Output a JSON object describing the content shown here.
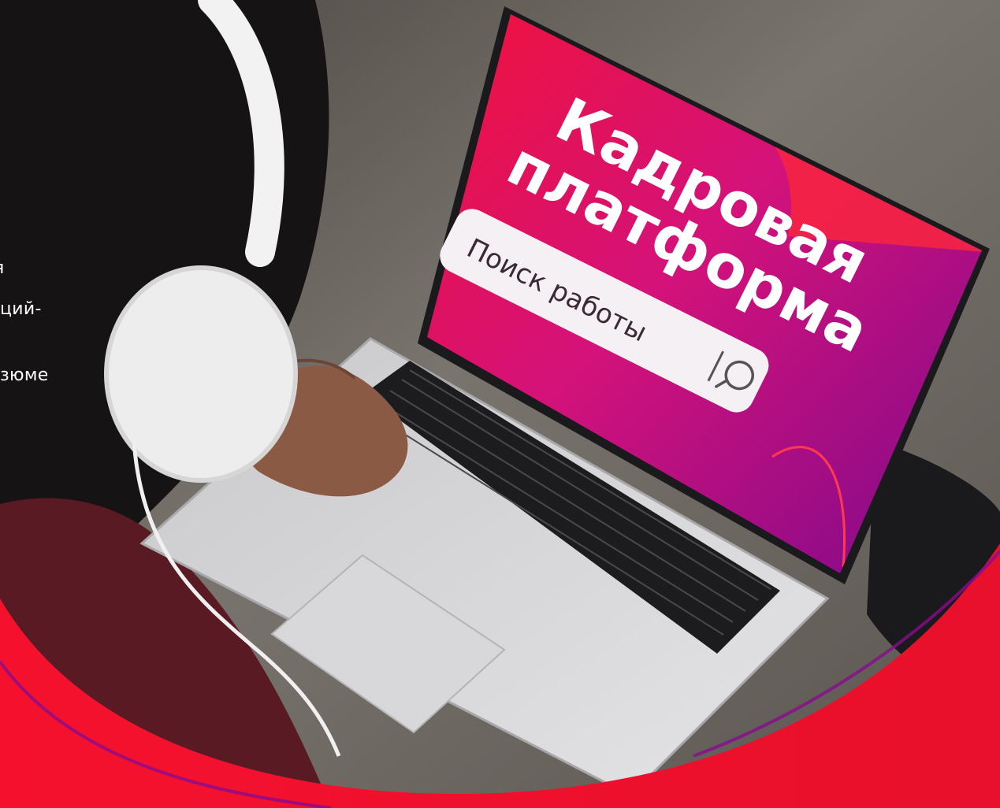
{
  "screen": {
    "title_line1": "Кадровая",
    "title_line2": "платформа",
    "search_placeholder": "Поиск работы"
  },
  "side_text": {
    "line1": "я",
    "line2": "ций-",
    "line3": "зюме"
  },
  "colors": {
    "brand_red": "#f5112e",
    "screen_magenta": "#d4127a",
    "screen_purple": "#8a0b8e"
  },
  "icons": {
    "search": "search-icon"
  }
}
